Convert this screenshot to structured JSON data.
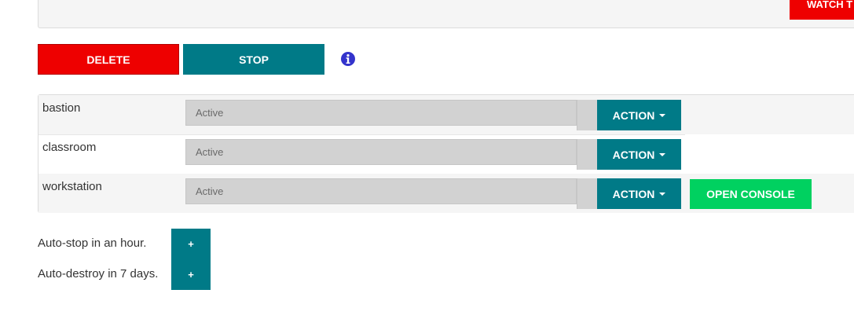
{
  "top_panel": {
    "watch_label": "WATCH T"
  },
  "controls": {
    "delete_label": "DELETE",
    "stop_label": "STOP",
    "info_icon": "info-circle-icon",
    "info_color": "#3333cc"
  },
  "machines": [
    {
      "name": "bastion",
      "status": "Active",
      "action_label": "ACTION"
    },
    {
      "name": "classroom",
      "status": "Active",
      "action_label": "ACTION"
    },
    {
      "name": "workstation",
      "status": "Active",
      "action_label": "ACTION",
      "console_label": "OPEN CONSOLE"
    }
  ],
  "auto": {
    "stop_text": "Auto-stop in an hour.",
    "destroy_text": "Auto-destroy in 7 days.",
    "plus_label": "+"
  },
  "colors": {
    "red": "#ee0000",
    "teal": "#007a87",
    "green": "#00d160"
  }
}
